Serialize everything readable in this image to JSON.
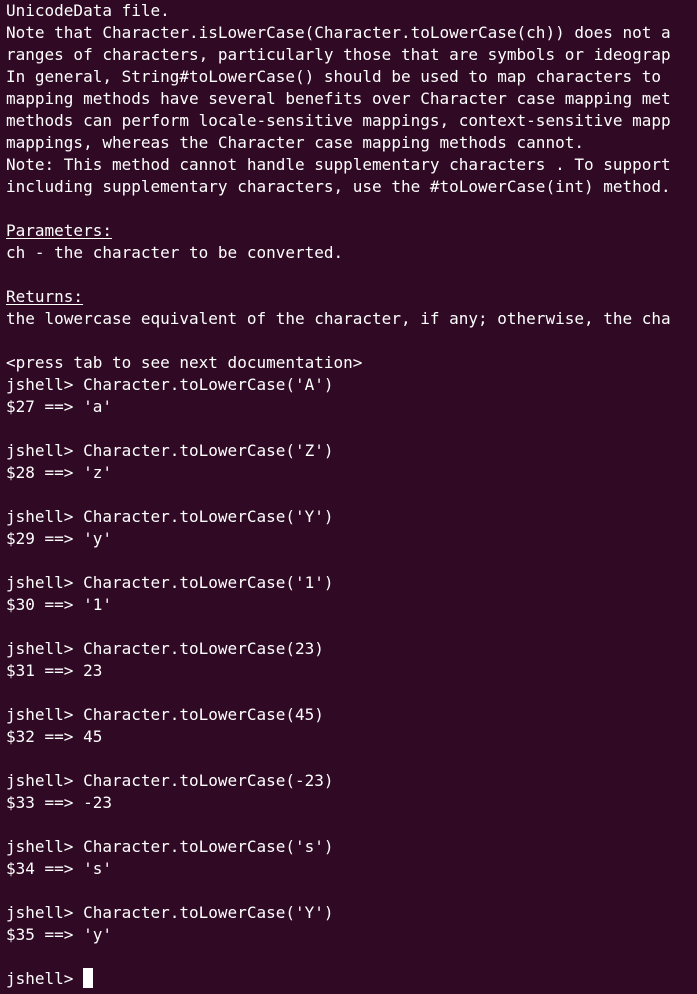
{
  "terminal": {
    "colors": {
      "background": "#300a24",
      "foreground": "#ffffff"
    },
    "doc_lines": [
      "UnicodeData file.",
      "Note that Character.isLowerCase(Character.toLowerCase(ch)) does not a",
      "ranges of characters, particularly those that are symbols or ideograp",
      "In general, String#toLowerCase() should be used to map characters to",
      "mapping methods have several benefits over Character case mapping met",
      "methods can perform locale-sensitive mappings, context-sensitive mapp",
      "mappings, whereas the Character case mapping methods cannot.",
      "Note: This method cannot handle supplementary characters . To support",
      "including supplementary characters, use the #toLowerCase(int) method."
    ],
    "params_heading": "Parameters:",
    "params_text": "ch - the character to be converted.",
    "returns_heading": "Returns:",
    "returns_text": "the lowercase equivalent of the character, if any; otherwise, the cha",
    "tab_hint": "<press tab to see next documentation>",
    "session": [
      {
        "prompt": "jshell> Character.toLowerCase('A')",
        "result": "$27 ==> 'a'"
      },
      {
        "prompt": "jshell> Character.toLowerCase('Z')",
        "result": "$28 ==> 'z'"
      },
      {
        "prompt": "jshell> Character.toLowerCase('Y')",
        "result": "$29 ==> 'y'"
      },
      {
        "prompt": "jshell> Character.toLowerCase('1')",
        "result": "$30 ==> '1'"
      },
      {
        "prompt": "jshell> Character.toLowerCase(23)",
        "result": "$31 ==> 23"
      },
      {
        "prompt": "jshell> Character.toLowerCase(45)",
        "result": "$32 ==> 45"
      },
      {
        "prompt": "jshell> Character.toLowerCase(-23)",
        "result": "$33 ==> -23"
      },
      {
        "prompt": "jshell> Character.toLowerCase('s')",
        "result": "$34 ==> 's'"
      },
      {
        "prompt": "jshell> Character.toLowerCase('Y')",
        "result": "$35 ==> 'y'"
      }
    ],
    "final_prompt": "jshell> "
  }
}
